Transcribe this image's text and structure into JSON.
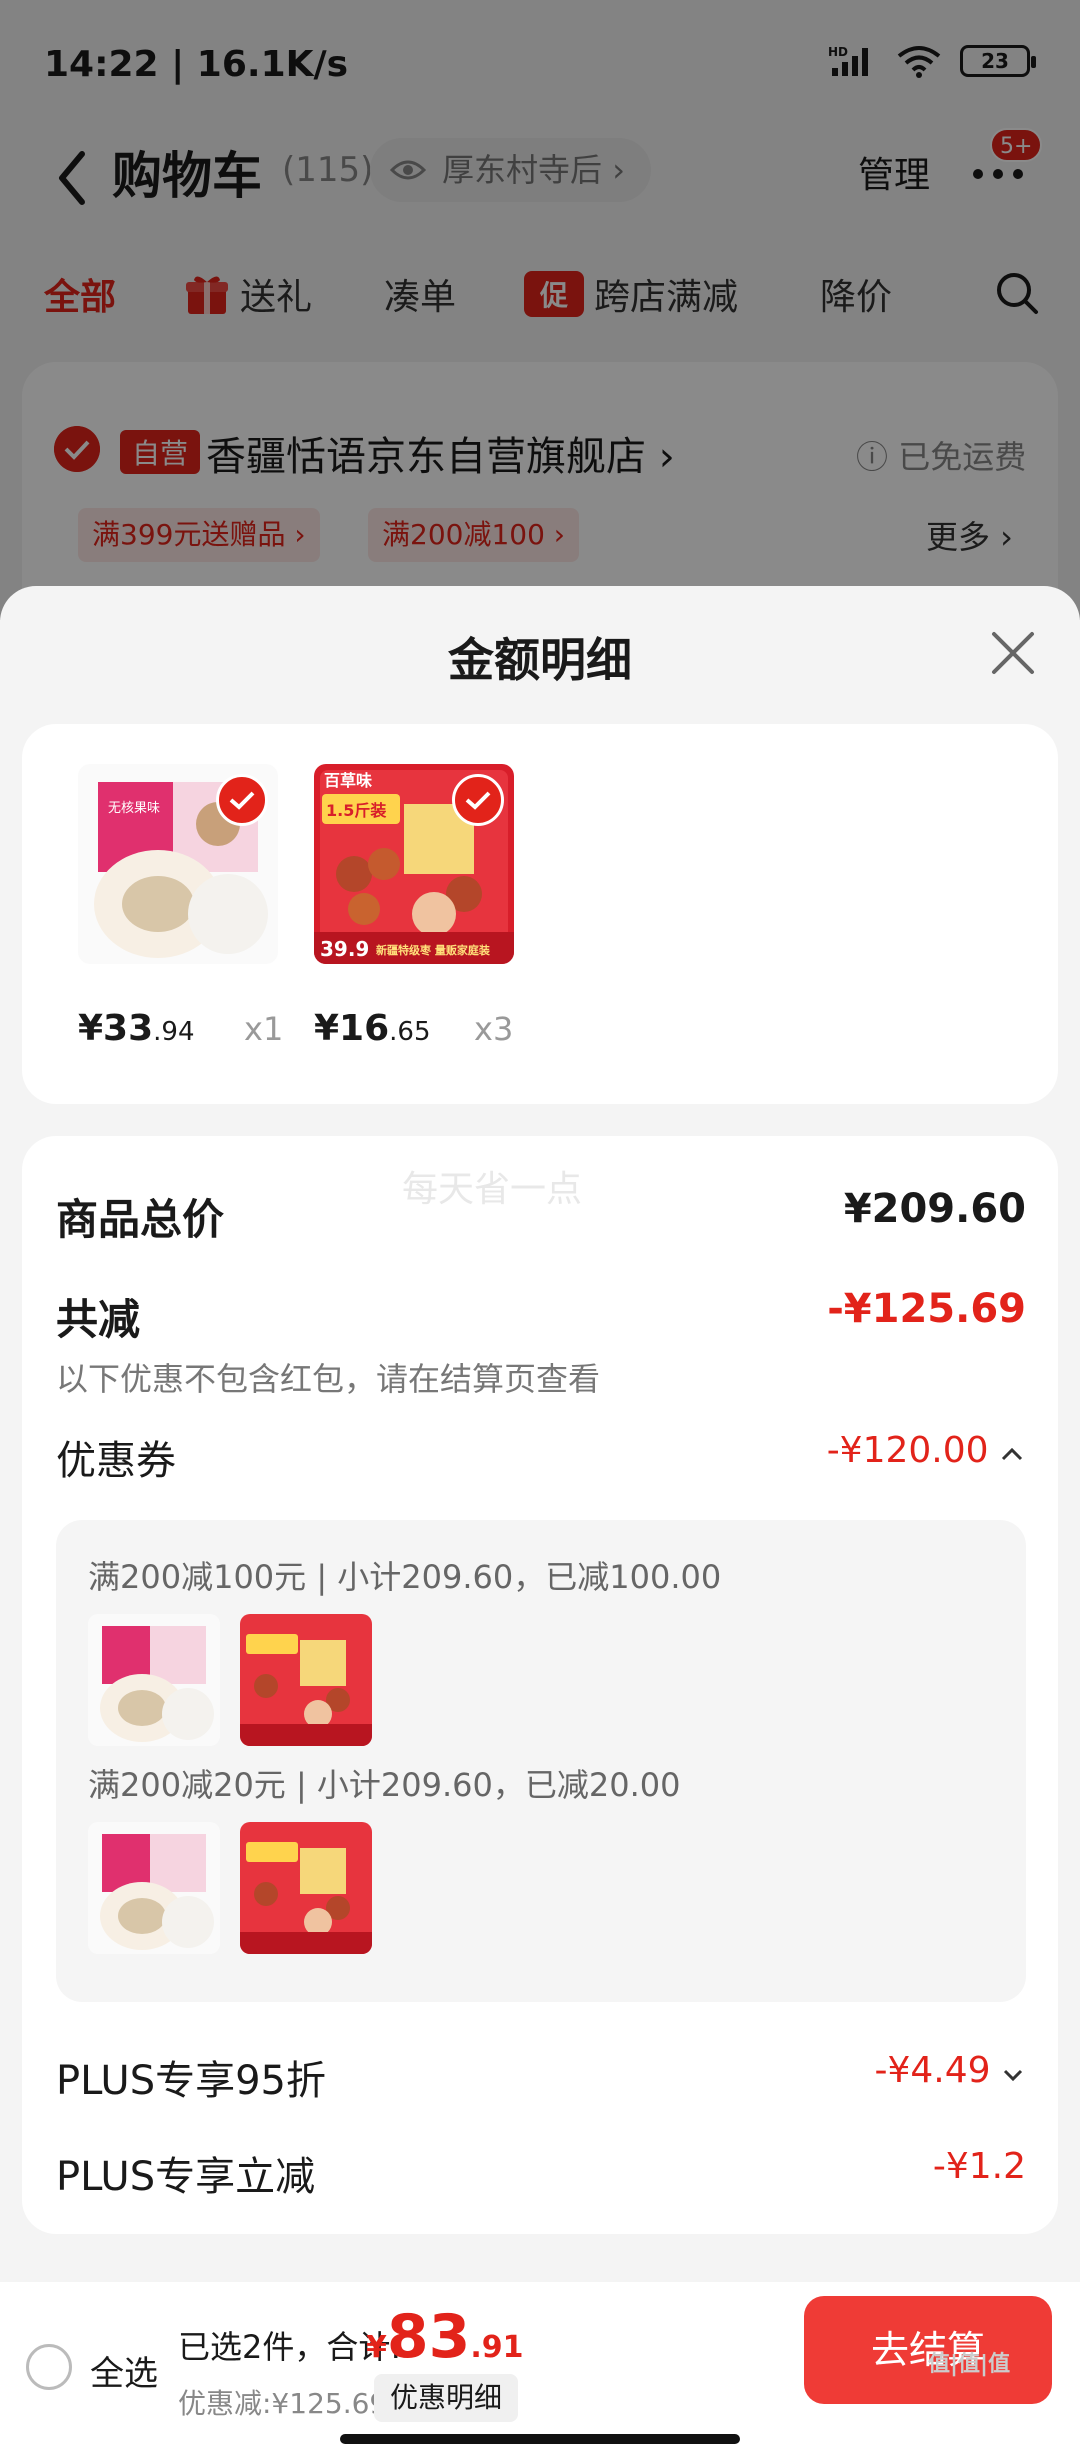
{
  "status_bar": {
    "time": "14:22 | 16.1K/s",
    "battery": "23",
    "signal": "HD"
  },
  "nav": {
    "back_icon": "chevron-left-icon",
    "title": "购物车",
    "count": "(115)",
    "location": "厚东村寺后",
    "manage": "管理",
    "badge": "5+"
  },
  "tabs": [
    {
      "label": "全部",
      "active": true
    },
    {
      "label": "送礼",
      "icon": "gift-icon"
    },
    {
      "label": "凑单"
    },
    {
      "label": "跨店满减",
      "tag": "促"
    },
    {
      "label": "降价"
    }
  ],
  "store": {
    "self_tag": "自营",
    "name": "香疆恬语京东自营旗舰店 ›",
    "shipping": "已免运费",
    "promos": [
      "满399元送赠品 ›",
      "满200减100 ›"
    ],
    "more": "更多 ›"
  },
  "sheet": {
    "title": "金额明细",
    "products": [
      {
        "price_main": "¥33",
        "price_cents": ".94",
        "qty": "x1"
      },
      {
        "price_main": "¥16",
        "price_cents": ".65",
        "qty": "x3"
      }
    ],
    "product_image_text": {
      "brand": "百草味",
      "weight": "1.5斤装",
      "price": "39.9",
      "slogan": "新疆特级枣 量贩家庭装",
      "box_text": "无核果味"
    },
    "watermark": "每天省一点",
    "total_label": "商品总价",
    "total_value": "¥209.60",
    "reduce_label": "共减",
    "reduce_value": "-¥125.69",
    "reduce_note": "以下优惠不包含红包，请在结算页查看",
    "coupon_label": "优惠券",
    "coupon_value": "-¥120.00",
    "coupon_rules": [
      "满200减100元 | 小计209.60，已减100.00",
      "满200减20元 | 小计209.60，已减20.00"
    ],
    "plus_discount_label": "PLUS专享95折",
    "plus_discount_value": "-¥4.49",
    "plus_reduce_label": "PLUS专享立减",
    "plus_reduce_value": "-¥1.2"
  },
  "bottom": {
    "select_all": "全选",
    "selected_text": "已选2件，合计:",
    "currency": "¥",
    "total_int": "83",
    "total_dec": ".91",
    "discount": "优惠减:¥125.69",
    "detail_button": "优惠明细",
    "checkout": "去结算",
    "site_mark": "值|值|值"
  },
  "colors": {
    "brand_red": "#e2231a",
    "checkout_red": "#ef3b36"
  }
}
